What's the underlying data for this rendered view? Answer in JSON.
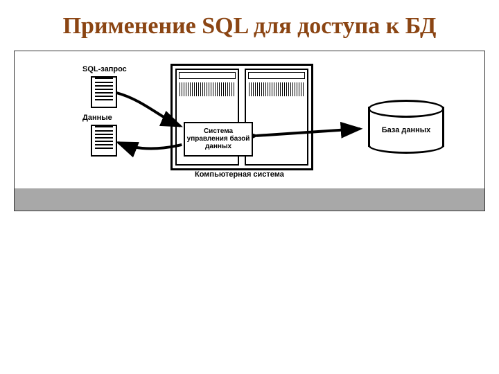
{
  "title": "Применение SQL для доступа к БД",
  "labels": {
    "sql_query": "SQL-запрос",
    "data": "Данные",
    "dbms": "Система управления базой данных",
    "database": "База данных",
    "computer_system": "Компьютерная система"
  }
}
